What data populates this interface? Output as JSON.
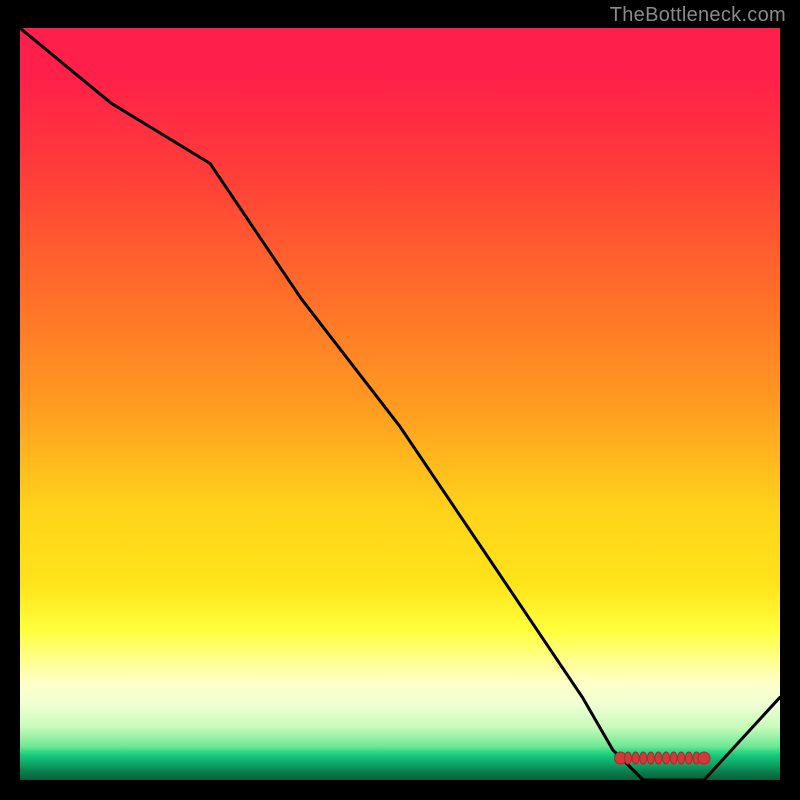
{
  "attribution": "TheBottleneck.com",
  "chart_data": {
    "type": "line",
    "title": "",
    "xlabel": "",
    "ylabel": "",
    "xlim": [
      0,
      100
    ],
    "ylim": [
      0,
      100
    ],
    "series": [
      {
        "name": "bottleneck-curve",
        "x": [
          0,
          12,
          25,
          37,
          50,
          62,
          74,
          78,
          82,
          86,
          90,
          100
        ],
        "values": [
          100,
          90,
          82,
          64,
          47,
          29,
          11,
          4,
          0,
          0,
          0,
          11
        ]
      }
    ],
    "markers": {
      "name": "optimal-range",
      "x": [
        79,
        80,
        81,
        82,
        83,
        84,
        85,
        86,
        87,
        88,
        89,
        90
      ],
      "values": [
        0,
        0,
        0,
        0,
        0,
        0,
        0,
        0,
        0,
        0,
        0,
        0
      ]
    },
    "grid": false,
    "legend": false
  },
  "colors": {
    "top": "#ff1f4b",
    "mid": "#ffe41a",
    "bottom": "#0c7a4c",
    "line": "#000000",
    "marker": "#d03a3a",
    "frame_bg": "#000000"
  }
}
